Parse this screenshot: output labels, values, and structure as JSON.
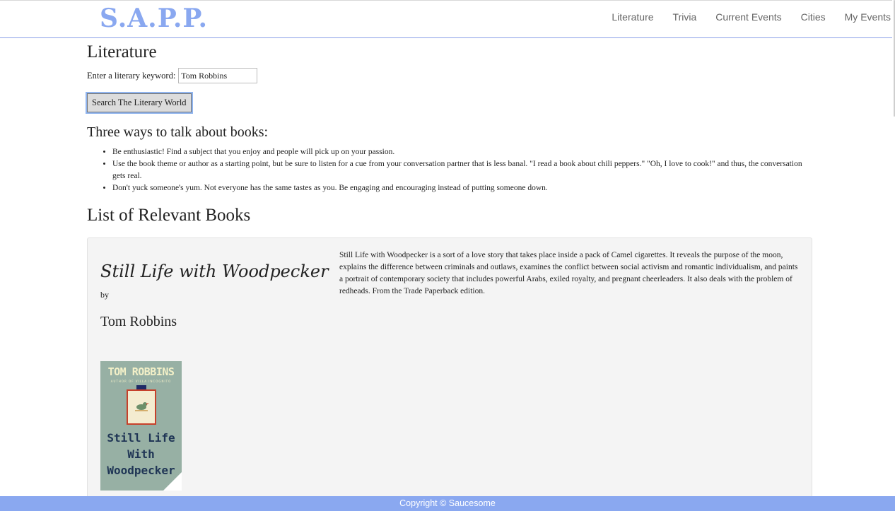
{
  "navbar": {
    "brand": "S.A.P.P.",
    "links": [
      "Literature",
      "Trivia",
      "Current Events",
      "Cities",
      "My Events"
    ]
  },
  "main": {
    "title": "Literature",
    "search_label": "Enter a literary keyword:",
    "search_value": "Tom Robbins",
    "search_button": "Search The Literary World",
    "tips_title": "Three ways to talk about books:",
    "tips": [
      "Be enthusiastic! Find a subject that you enjoy and people will pick up on your passion.",
      "Use the book theme or author as a starting point, but be sure to listen for a cue from your conversation partner that is less banal. \"I read a book about chili peppers.\" \"Oh, I love to cook!\" and thus, the conversation gets real.",
      "Don't yuck someone's yum. Not everyone has the same tastes as you. Be engaging and encouraging instead of putting someone down."
    ],
    "books_title": "List of Relevant Books"
  },
  "book": {
    "title": "Still Life with Woodpecker",
    "by": "by",
    "author": "Tom Robbins",
    "description": "Still Life with Woodpecker is a sort of a love story that takes place inside a pack of Camel cigarettes. It reveals the purpose of the moon, explains the difference between criminals and outlaws, examines the conflict between social activism and romantic individualism, and paints a portrait of contemporary society that includes powerful Arabs, exiled royalty, and pregnant cheerleaders. It also deals with the problem of redheads. From the Trade Paperback edition.",
    "cover": {
      "author": "TOM ROBBINS",
      "subtitle": "AUTHOR OF VILLA INCOGNITO",
      "title_lines": [
        "Still Life",
        "With",
        "Woodpecker"
      ]
    }
  },
  "footer": {
    "text": "Copyright © Saucesome"
  },
  "colors": {
    "accent": "#8aa8f0",
    "card_bg": "#f4f4f4",
    "cover_bg": "#97b0a4"
  }
}
